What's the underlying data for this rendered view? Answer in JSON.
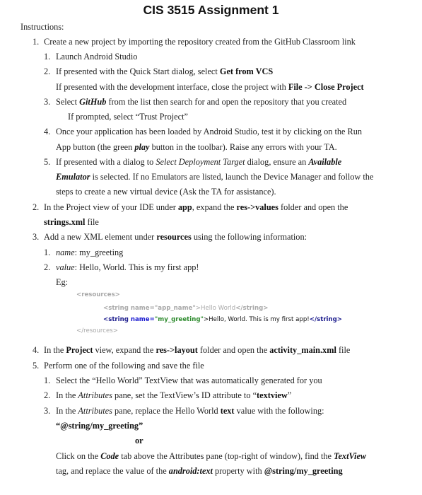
{
  "title": "CIS 3515 Assignment 1",
  "instructions_label": "Instructions:",
  "steps": {
    "s1": {
      "num": "1.",
      "text": "Create a new project by importing the repository created from the GitHub Classroom link",
      "sub": {
        "a": {
          "num": "1.",
          "text": "Launch Android Studio"
        },
        "b": {
          "num": "2.",
          "pre": "If presented with the Quick Start dialog, select ",
          "bold": "Get from VCS",
          "line2_pre": "If presented with the development interface, close the project with ",
          "line2_bold": "File -> Close Project"
        },
        "c": {
          "num": "3.",
          "pre": "Select ",
          "bolditalic": "GitHub",
          "post": " from the list then search for and open the repository that you created",
          "line2": "If prompted, select “Trust Project”"
        },
        "d": {
          "num": "4.",
          "line1": "Once your application has been loaded by Android Studio, test it by clicking on the Run",
          "line2_pre": "App button (the green ",
          "line2_bi": "play",
          "line2_post": " button in the toolbar). Raise any errors with your TA."
        },
        "e": {
          "num": "5.",
          "pre": "If presented with a dialog to ",
          "italic": "Select Deployment Target",
          "mid": " dialog, ensure an ",
          "bi": "Available",
          "line2_bi": "Emulator",
          "line2_post": " is selected. If no Emulators are listed, launch the Device Manager and follow the",
          "line3": "steps to create a new virtual device (Ask the TA for assistance)."
        }
      }
    },
    "s2": {
      "num": "2.",
      "pre": "In the Project view of your IDE under ",
      "b1": "app",
      "mid": ", expand the ",
      "b2": "res->values",
      "post": " folder and open the",
      "line2_bold": "strings.xml",
      "line2_post": " file"
    },
    "s3": {
      "num": "3.",
      "pre": "Add a new XML element under ",
      "bold": "resources",
      "post": " using the following information:",
      "sub": {
        "a": {
          "num": "1.",
          "italic": "name",
          "text": ": my_greeting"
        },
        "b": {
          "num": "2.",
          "italic": "value",
          "text": ": Hello, World. This is my first app!"
        }
      },
      "eg_label": "Eg:",
      "code": {
        "open_tag": "<resources>",
        "line1_tag": "<string",
        "line1_attr": " name=",
        "line1_val": "\"app_name\"",
        "line1_text": ">Hello World",
        "line1_close": "</string>",
        "line2_tag": "<string",
        "line2_attr": " name=",
        "line2_val": "\"my_greeting\"",
        "line2_text": ">Hello, World. This is my first app!",
        "line2_close_a": "</",
        "line2_close_b": "string",
        "line2_close_c": ">",
        "close_tag": "</resources>"
      }
    },
    "s4": {
      "num": "4.",
      "pre": "In the ",
      "b1": "Project",
      "mid1": " view, expand the ",
      "b2": "res->layout",
      "mid2": " folder and open the ",
      "b3": "activity_main.xml",
      "post": " file"
    },
    "s5": {
      "num": "5.",
      "text": "Perform one of the following and save the file",
      "sub": {
        "a": {
          "num": "1.",
          "text": "Select the “Hello World” TextView that was automatically generated for you"
        },
        "b": {
          "num": "2.",
          "pre": "In the ",
          "italic": "Attributes",
          "mid": " pane, set the TextView’s ID attribute to “",
          "bold": "textview",
          "post": "”"
        },
        "c": {
          "num": "3.",
          "pre": "In the ",
          "italic": "Attributes",
          "mid": " pane, replace the Hello World ",
          "bold": "text",
          "post": " value with the following:",
          "value_line": "“@string/my_greeting”",
          "or": "or",
          "alt1_pre": "Click on the ",
          "alt1_bi": "Code",
          "alt1_mid": " tab above the Attributes pane (top-right of window), find the ",
          "alt1_bi2": "TextView",
          "alt2_pre": "tag, and replace the value of the ",
          "alt2_bi": "android:text",
          "alt2_mid": " property with ",
          "alt2_bold": "@string/my_greeting"
        }
      }
    }
  }
}
